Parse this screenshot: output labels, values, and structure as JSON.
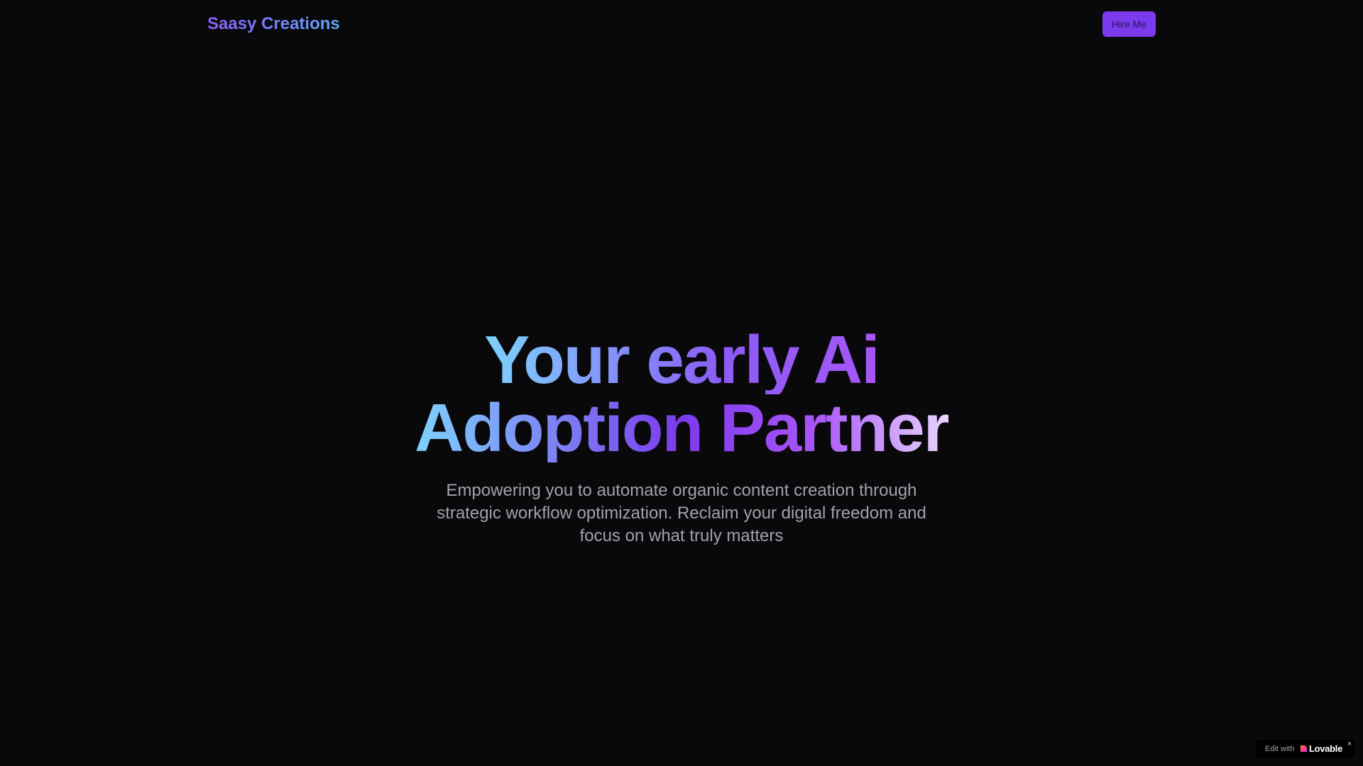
{
  "navbar": {
    "brand": "Saasy Creations",
    "hire_label": "Hire Me"
  },
  "hero": {
    "title_line1": "Your early Ai",
    "title_line2": "Adoption Partner",
    "subtitle": "Empowering you to automate organic content creation through strategic workflow optimization. Reclaim your digital freedom and focus on what truly matters"
  },
  "badge": {
    "edit_text": "Edit with",
    "brand": "Lovable",
    "close_glyph": "×",
    "icon": "lovable-heart-icon"
  },
  "colors": {
    "background": "#09090b",
    "accent": "#7c3aed",
    "gradient_start": "#7dd3fc",
    "gradient_mid": "#8b5cf6",
    "gradient_end": "#e9d5ff",
    "subtitle_text": "#a1a1aa"
  }
}
